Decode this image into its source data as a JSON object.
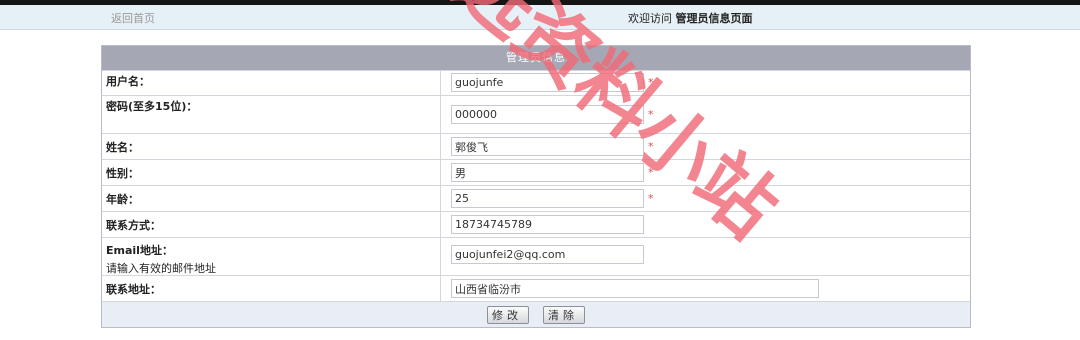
{
  "header": {
    "back_link": "返回首页",
    "welcome_prefix": "欢迎访问",
    "welcome_title": "管理员信息页面"
  },
  "panel": {
    "title": "管理员信息"
  },
  "form": {
    "username": {
      "label": "用户名：",
      "value": "guojunfe",
      "required": "*"
    },
    "password": {
      "label": "密码(至多15位)：",
      "value": "000000",
      "required": "*"
    },
    "name": {
      "label": "姓名：",
      "value": "郭俊飞",
      "required": "*"
    },
    "gender": {
      "label": "性别：",
      "value": "男",
      "required": "*"
    },
    "age": {
      "label": "年龄：",
      "value": "25",
      "required": "*"
    },
    "contact": {
      "label": "联系方式：",
      "value": "18734745789"
    },
    "email": {
      "label": "Email地址：",
      "hint": "请输入有效的邮件地址",
      "value": "guojunfei2@qq.com"
    },
    "address": {
      "label": "联系地址：",
      "value": "山西省临汾市"
    }
  },
  "buttons": {
    "modify": "修改",
    "clear": "清除"
  },
  "watermark": {
    "text": "精选资料小站",
    "color": "#f06a78"
  }
}
